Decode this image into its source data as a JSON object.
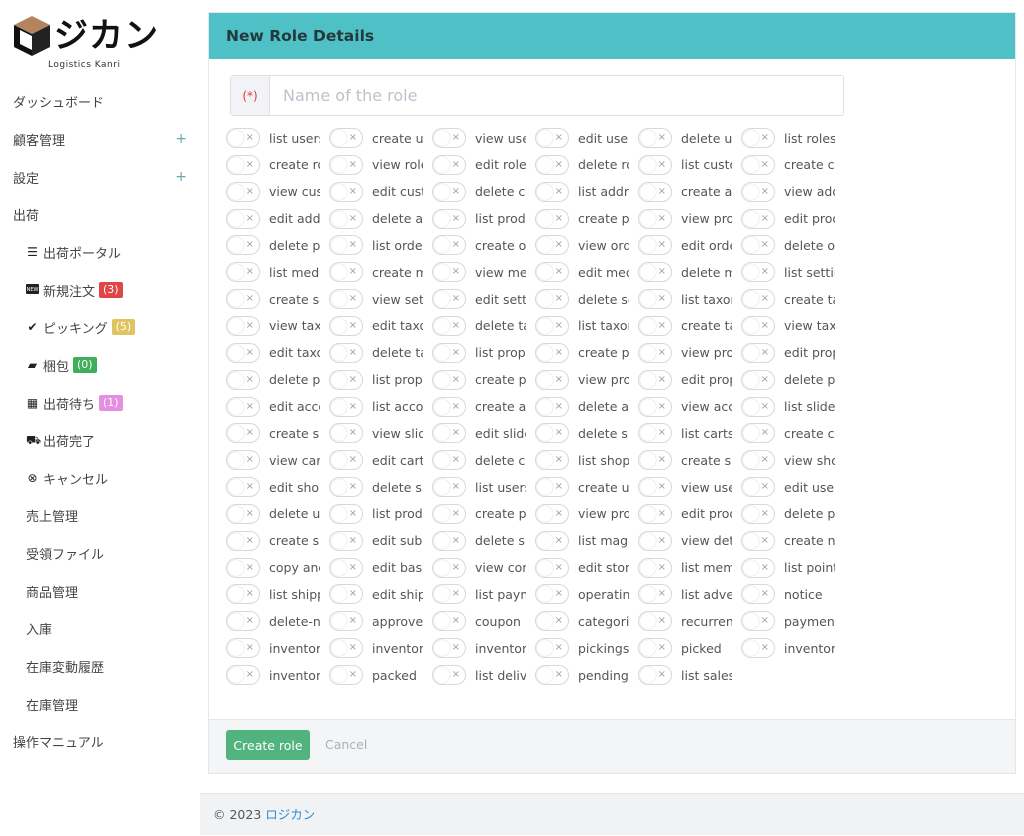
{
  "brand": {
    "name": "ジカン",
    "sub": "Logistics Kanri"
  },
  "sidebar": {
    "items": [
      {
        "label": "ダッシュボード"
      },
      {
        "label": "顧客管理",
        "expand": "+"
      },
      {
        "label": "設定",
        "expand": "+"
      },
      {
        "label": "出荷"
      },
      {
        "label": "出荷ポータル",
        "icon": "list-icon"
      },
      {
        "label": "新規注文",
        "icon": "new-badge-icon",
        "badge": "(3)",
        "badge_color": "#e04646"
      },
      {
        "label": "ピッキング",
        "icon": "check-icon",
        "badge": "(5)",
        "badge_color": "#e0c460"
      },
      {
        "label": "梱包",
        "icon": "box-icon",
        "badge": "(0)",
        "badge_color": "#3fae5a"
      },
      {
        "label": "出荷待ち",
        "icon": "calendar-icon",
        "badge": "(1)",
        "badge_color": "#e48fe0"
      },
      {
        "label": "出荷完了",
        "icon": "truck-icon"
      },
      {
        "label": "キャンセル",
        "icon": "cancel-icon"
      },
      {
        "label": "売上管理"
      },
      {
        "label": "受領ファイル"
      },
      {
        "label": "商品管理"
      },
      {
        "label": "入庫"
      },
      {
        "label": "在庫変動履歴"
      },
      {
        "label": "在庫管理"
      },
      {
        "label": "操作マニュアル"
      }
    ]
  },
  "panel": {
    "title": "New Role Details",
    "required_mark": "(*)",
    "name_placeholder": "Name of the role",
    "permissions": [
      "list users",
      "create users",
      "view users",
      "edit users",
      "delete users",
      "list roles",
      "create roles",
      "view roles",
      "edit roles",
      "delete roles",
      "list customers",
      "create customers",
      "view customers",
      "edit customers",
      "delete customers",
      "list addresses",
      "create addresses",
      "view addresses",
      "edit addresses",
      "delete addresses",
      "list products",
      "create products",
      "view products",
      "edit products",
      "delete products",
      "list orders",
      "create orders",
      "view orders",
      "edit orders",
      "delete orders",
      "list media",
      "create media",
      "view media",
      "edit media",
      "delete media",
      "list settings",
      "create settings",
      "view settings",
      "edit settings",
      "delete settings",
      "list taxonomies",
      "create taxonomies",
      "view taxonomies",
      "edit taxonomies",
      "delete taxonomies",
      "list taxonomies",
      "create taxonomies",
      "view taxonomies",
      "edit taxonomies",
      "delete taxonomies",
      "list properties",
      "create properties",
      "view properties",
      "edit properties",
      "delete properties",
      "list properties",
      "create properties",
      "view properties",
      "edit properties",
      "delete properties",
      "edit accounts",
      "list accounts",
      "create accounts",
      "delete accounts",
      "view accounts",
      "list sliders",
      "create sliders",
      "view sliders",
      "edit sliders",
      "delete sliders",
      "list carts",
      "create carts",
      "view carts",
      "edit carts",
      "delete carts",
      "list shops",
      "create shops",
      "view shops",
      "edit shops",
      "delete shops",
      "list users",
      "create users",
      "view users",
      "edit users",
      "delete users",
      "list products",
      "create products",
      "view products",
      "edit products",
      "delete products",
      "create subscriptions",
      "edit subscriptions",
      "delete subscriptions",
      "list magazines",
      "view details",
      "create news",
      "copy and paste",
      "edit base",
      "view contents",
      "edit store",
      "list members",
      "list points",
      "list shipping",
      "edit shipping",
      "list payments",
      "operating",
      "list advertisements",
      "notice",
      "delete-news",
      "approve",
      "coupon",
      "categories",
      "recurrent",
      "payment",
      "inventory",
      "inventory",
      "inventory",
      "pickings",
      "picked",
      "inventory",
      "inventory",
      "packed",
      "list delivery",
      "pending",
      "list sales"
    ]
  },
  "footer": {
    "create_label": "Create role",
    "cancel_label": "Cancel",
    "copyright": "© 2023 ",
    "copyright_link": "ロジカン"
  }
}
